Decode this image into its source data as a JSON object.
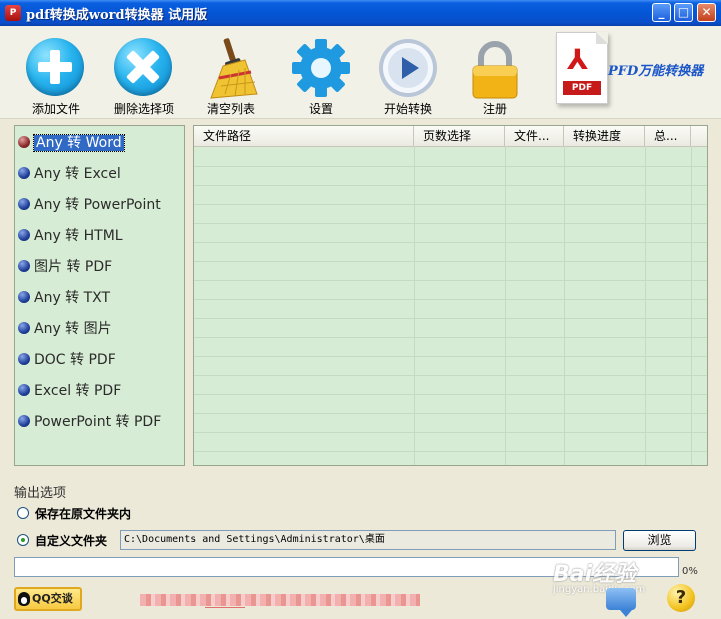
{
  "window": {
    "title": "pdf转换成word转换器 试用版",
    "icon_text": "P",
    "controls": {
      "minimize": "_",
      "maximize": "□",
      "close": "✕"
    }
  },
  "toolbar": {
    "items": [
      {
        "label": "添加文件",
        "icon": "plus-circle-icon"
      },
      {
        "label": "删除选择项",
        "icon": "x-circle-icon"
      },
      {
        "label": "清空列表",
        "icon": "broom-icon"
      },
      {
        "label": "设置",
        "icon": "gear-icon"
      },
      {
        "label": "开始转换",
        "icon": "play-icon"
      },
      {
        "label": "注册",
        "icon": "padlock-icon"
      }
    ],
    "brand": {
      "doc_symbol": "⅄",
      "doc_tag": "PDF",
      "text": "PFD万能转换器"
    }
  },
  "conversions": {
    "selected_index": 0,
    "items": [
      "Any 转 Word",
      "Any 转 Excel",
      "Any 转 PowerPoint",
      "Any 转 HTML",
      "图片 转 PDF",
      "Any 转 TXT",
      "Any 转 图片",
      "DOC 转 PDF",
      "Excel 转 PDF",
      "PowerPoint 转 PDF"
    ]
  },
  "file_table": {
    "columns": [
      "文件路径",
      "页数选择",
      "文件...",
      "转换进度",
      "总..."
    ],
    "rows": []
  },
  "output": {
    "section_title": "输出选项",
    "options": [
      {
        "label": "保存在原文件夹内",
        "checked": false
      },
      {
        "label": "自定义文件夹",
        "checked": true
      }
    ],
    "path_value": "C:\\Documents and Settings\\Administrator\\桌面",
    "browse_label": "浏览"
  },
  "progress": {
    "value": 0,
    "label": "0%"
  },
  "footer": {
    "qq_label": "QQ交谈",
    "help_symbol": "?"
  },
  "watermark": {
    "text": "Bai经验",
    "sub": "jingyan.baidu.com"
  },
  "colors": {
    "titlebar": "#0456d6",
    "list_bg": "#d6ecd4",
    "selection": "#316ac5",
    "brand_text": "#1a56c8"
  }
}
